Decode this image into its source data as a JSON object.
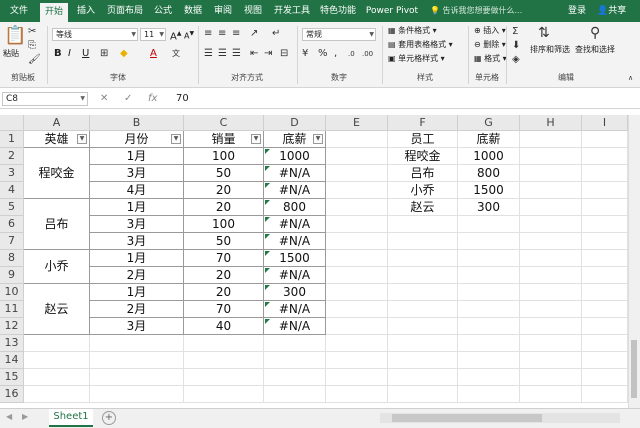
{
  "tabs": [
    "文件",
    "开始",
    "插入",
    "页面布局",
    "公式",
    "数据",
    "审阅",
    "视图",
    "开发工具",
    "特色功能",
    "Power Pivot"
  ],
  "active_tab": "开始",
  "tell_me": "告诉我您想要做什么...",
  "account": {
    "login": "登录",
    "share": "共享"
  },
  "ribbon": {
    "clipboard": {
      "label": "剪贴板",
      "paste": "粘贴"
    },
    "font": {
      "label": "字体",
      "name": "等线",
      "size": "11",
      "bold": "B",
      "italic": "I",
      "underline": "U",
      "grow": "A",
      "shrink": "A",
      "color": "A"
    },
    "alignment": {
      "label": "对齐方式"
    },
    "number": {
      "label": "数字",
      "format": "常规"
    },
    "styles": {
      "label": "样式",
      "conditional": "条件格式",
      "table": "套用表格格式",
      "cell": "单元格样式"
    },
    "cells": {
      "label": "单元格",
      "insert": "插入",
      "delete": "删除",
      "format": "格式"
    },
    "editing": {
      "label": "编辑",
      "sort_filter": "排序和筛选",
      "find_select": "查找和选择"
    }
  },
  "formula_bar": {
    "name_box": "C8",
    "fx": "fx",
    "value": "70"
  },
  "columns": [
    "A",
    "B",
    "C",
    "D",
    "E",
    "F",
    "G",
    "H",
    "I"
  ],
  "rows": [
    "1",
    "2",
    "3",
    "4",
    "5",
    "6",
    "7",
    "8",
    "9",
    "10",
    "11",
    "12",
    "13",
    "14",
    "15",
    "16"
  ],
  "table": {
    "headers": [
      "英雄",
      "月份",
      "销量",
      "底薪"
    ],
    "heroes": [
      {
        "name": "程咬金",
        "rows": [
          [
            "1月",
            "100",
            "1000"
          ],
          [
            "3月",
            "50",
            "#N/A"
          ],
          [
            "4月",
            "20",
            "#N/A"
          ]
        ]
      },
      {
        "name": "吕布",
        "rows": [
          [
            "1月",
            "20",
            "800"
          ],
          [
            "3月",
            "100",
            "#N/A"
          ],
          [
            "3月",
            "50",
            "#N/A"
          ]
        ]
      },
      {
        "name": "小乔",
        "rows": [
          [
            "1月",
            "70",
            "1500"
          ],
          [
            "2月",
            "20",
            "#N/A"
          ]
        ]
      },
      {
        "name": "赵云",
        "rows": [
          [
            "1月",
            "20",
            "300"
          ],
          [
            "2月",
            "70",
            "#N/A"
          ],
          [
            "3月",
            "40",
            "#N/A"
          ]
        ]
      }
    ]
  },
  "lookup": {
    "headers": [
      "员工",
      "底薪"
    ],
    "rows": [
      [
        "程咬金",
        "1000"
      ],
      [
        "吕布",
        "800"
      ],
      [
        "小乔",
        "1500"
      ],
      [
        "赵云",
        "300"
      ]
    ]
  },
  "sheet": {
    "name": "Sheet1",
    "add": "+"
  }
}
